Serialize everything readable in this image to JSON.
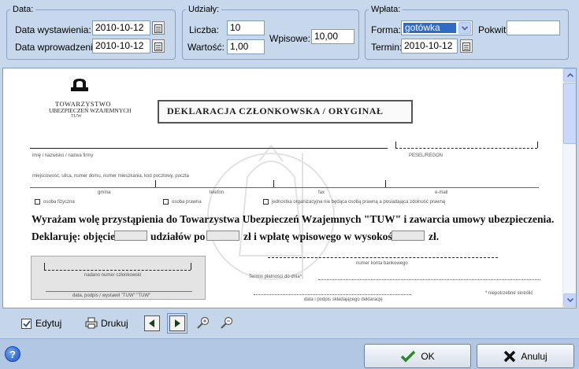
{
  "data_group": {
    "legend": "Data:",
    "issue_label": "Data wystawienia:",
    "issue_value": "2010-10-12",
    "entry_label": "Data wprowadzenia:",
    "entry_value": "2010-10-12"
  },
  "shares_group": {
    "legend": "Udziały:",
    "count_label": "Liczba:",
    "count_value": "10",
    "value_label": "Wartość:",
    "value_value": "1,00",
    "fee_label": "Wpisowe:",
    "fee_value": "10,00"
  },
  "payment_group": {
    "legend": "Wpłata:",
    "form_label": "Forma:",
    "form_value": "gotówka",
    "receipt_label": "Pokwit.",
    "receipt_value": "",
    "term_label": "Termin:",
    "term_value": "2010-10-12"
  },
  "document": {
    "logo_line1": "TOWARZYSTWO",
    "logo_line2": "UBEZPIECZEŃ WZAJEMNYCH",
    "logo_line3": "TUW",
    "title": "DEKLARACJA CZŁONKOWSKA / ORYGINAŁ",
    "field_name": "imię i nazwisko / nazwa firmy",
    "field_pesel": "PESEL/REGON",
    "field_address": "miejscowość, ulica, numer domu, numer mieszkania, kod pocztowy, poczta",
    "field_gmina": "gmina",
    "field_phone": "telefon",
    "field_fax": "fax",
    "field_email": "e-mail",
    "opt_person": "osoba fizyczna",
    "opt_legal": "osoba prawna",
    "opt_org": "jednostka organizacyjna nie będąca osobą prawną a posiadająca zdolność prawną",
    "declaration_line": "Wyrażam wolę przystąpienia do Towarzystwa Ubezpieczeń Wzajemnych \"TUW\" i zawarcia umowy ubezpieczenia.",
    "declare_part1": "Deklaruję:  objęcie",
    "declare_part2": "udziałów po",
    "declare_part3": "zł i wpłatę wpisowego w wysokości",
    "declare_part4": "zł.",
    "member_number": "nadano numer członkowski",
    "account_number": "numer konta bankowego",
    "payment_term": "Termin płatności do dnia*",
    "sign_tuw": "data, podpis / wystawił \"TUW\" \"TUW\"",
    "sign_declarant": "data i podpis składającego deklarację",
    "footnote": "* niepotrzebne skreślić"
  },
  "toolbar": {
    "edit_label": "Edytuj",
    "print_label": "Drukuj"
  },
  "buttons": {
    "ok_label": "OK",
    "cancel_label": "Anuluj"
  },
  "colors": {
    "background": "#c5d6ea",
    "selection": "#316ac5",
    "ok_check": "#2a8a2a",
    "cancel_x": "#111111"
  }
}
